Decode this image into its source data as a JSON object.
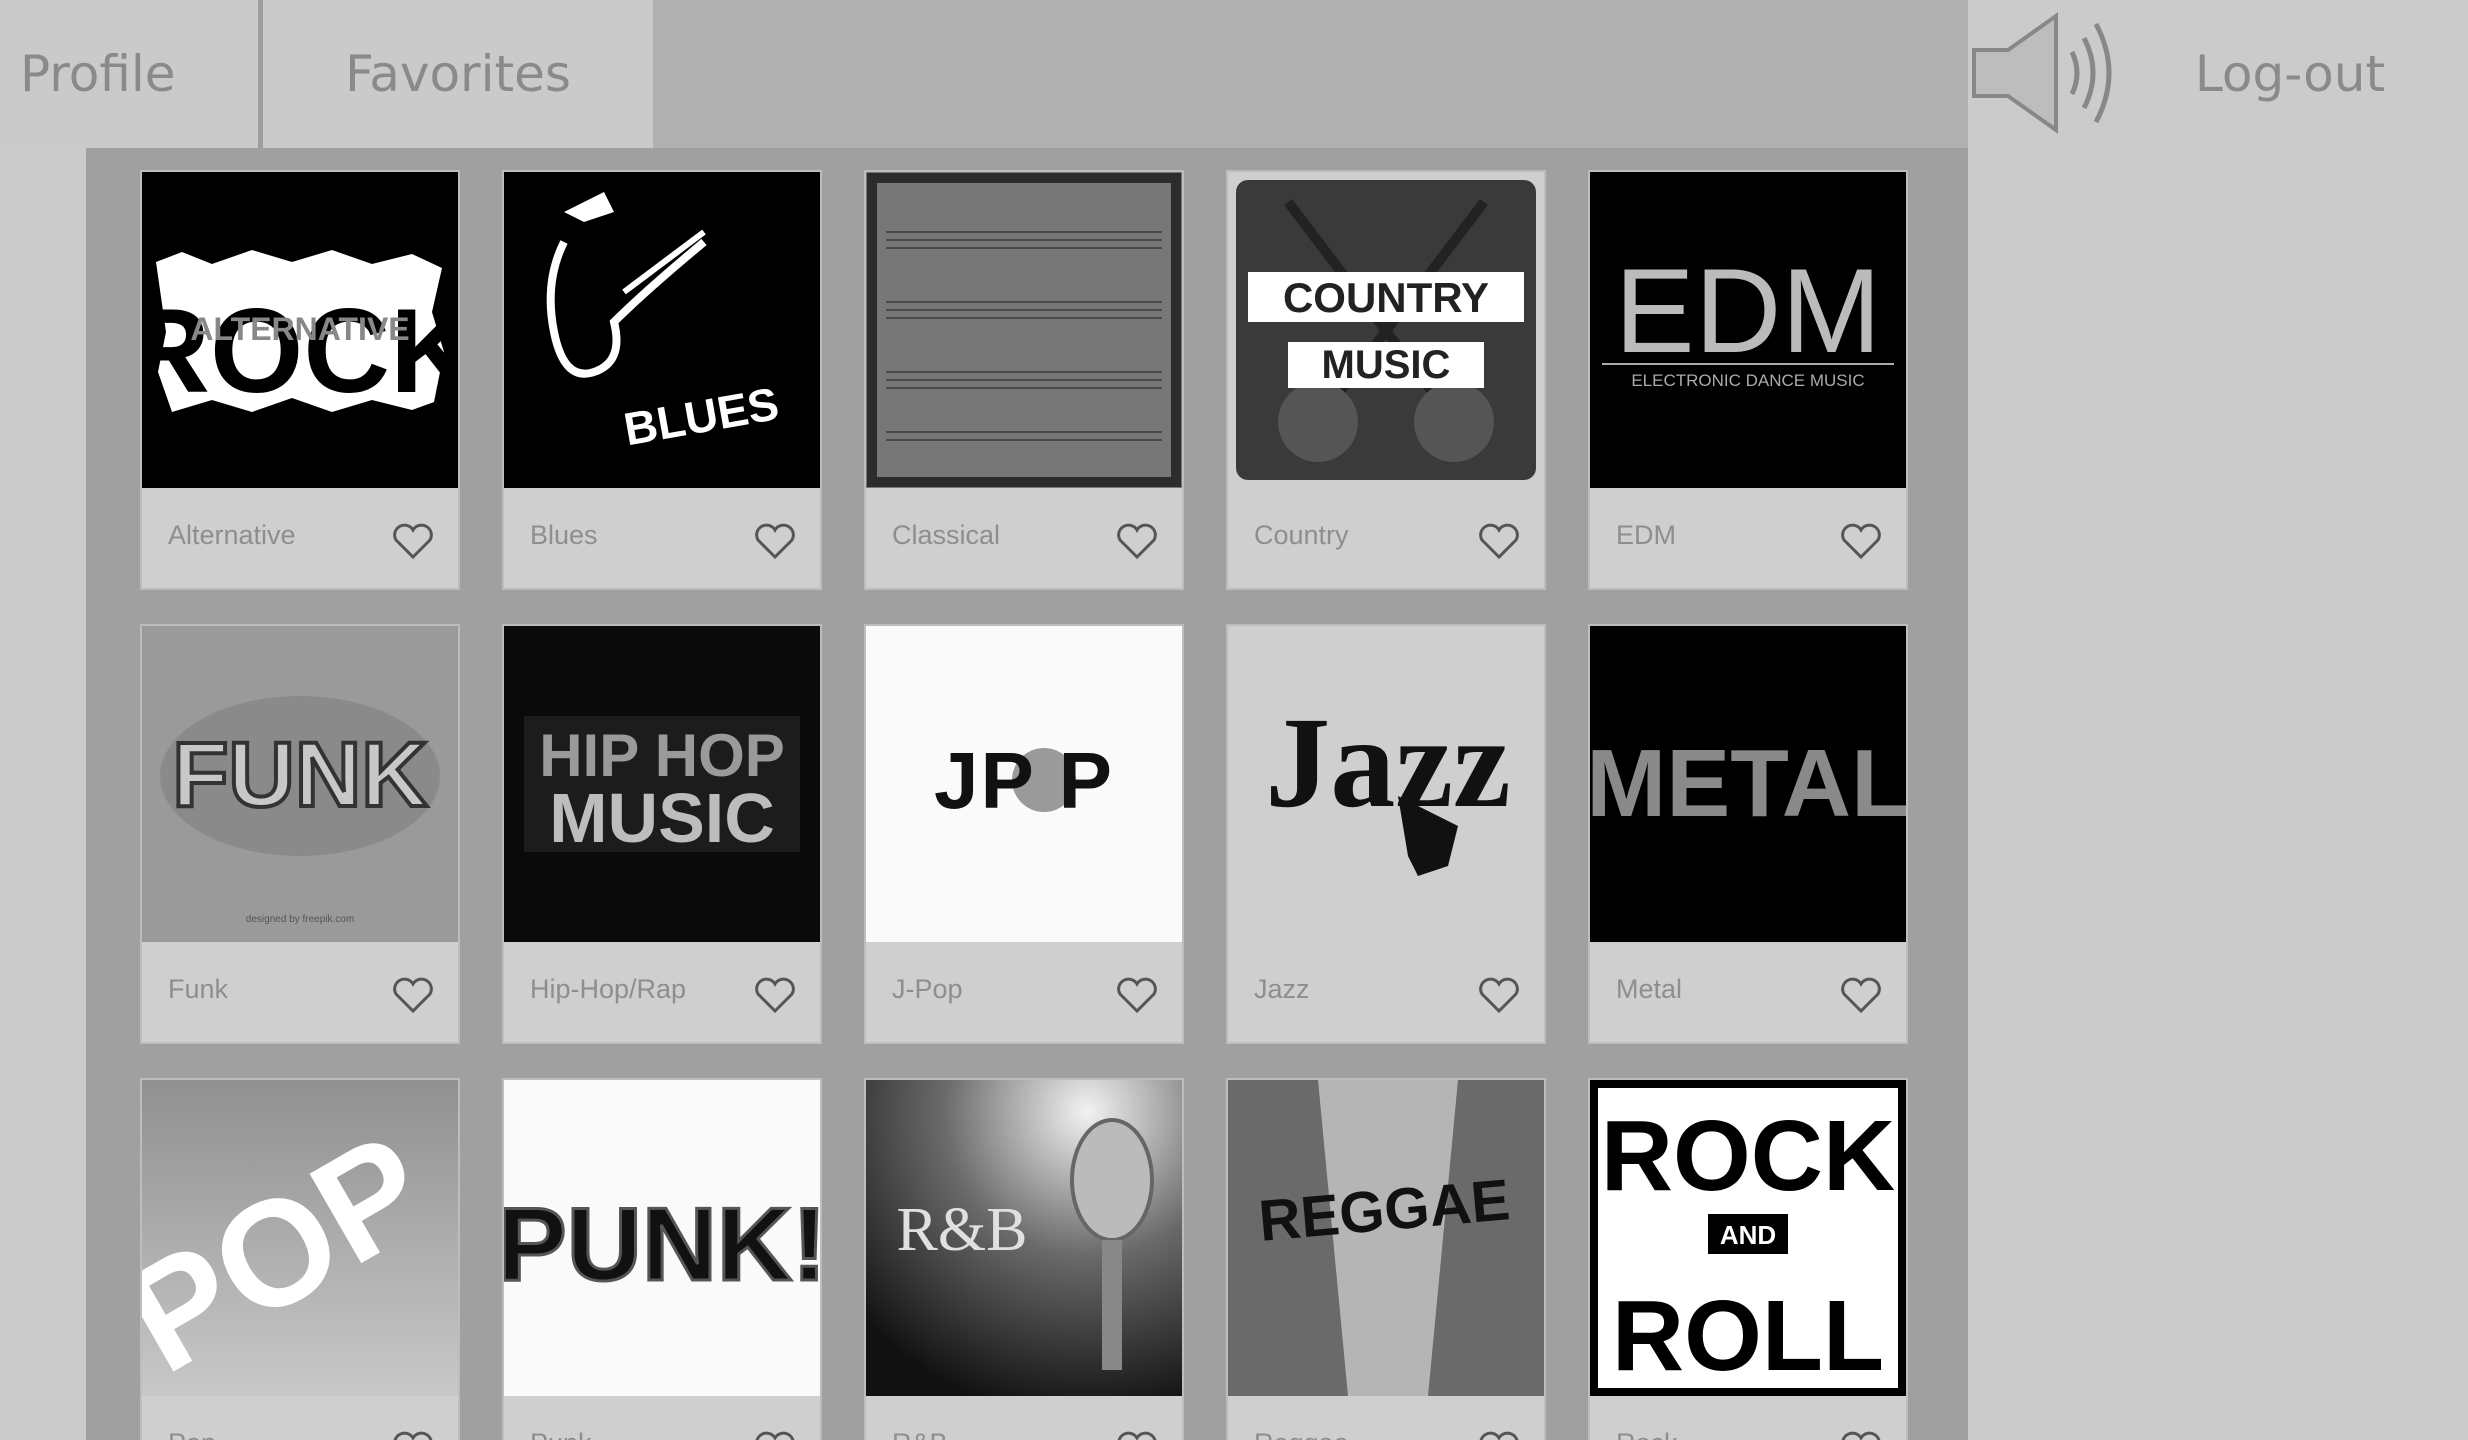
{
  "nav": {
    "profile_label": "Profile",
    "favorites_label": "Favorites",
    "logout_label": "Log-out",
    "volume_icon": "speaker-volume-icon"
  },
  "genres": [
    {
      "label": "Alternative",
      "art": "ROCK",
      "art_sub": "ALTERNATIVE"
    },
    {
      "label": "Blues",
      "art": "BLUES"
    },
    {
      "label": "Classical"
    },
    {
      "label": "Country",
      "art": "COUNTRY",
      "art_sub": "MUSIC"
    },
    {
      "label": "EDM",
      "art": "EDM",
      "art_sub": "ELECTRONIC DANCE MUSIC"
    },
    {
      "label": "Funk",
      "art": "FUNK",
      "art_sub": "designed by freepik.com"
    },
    {
      "label": "Hip-Hop/Rap",
      "art": "HIP HOP",
      "art_sub": "MUSIC"
    },
    {
      "label": "J-Pop",
      "art": "JP P"
    },
    {
      "label": "Jazz",
      "art": "Jazz"
    },
    {
      "label": "Metal",
      "art": "METAL"
    },
    {
      "label": "Pop",
      "art": "POP"
    },
    {
      "label": "Punk",
      "art": "PUNK!"
    },
    {
      "label": "R&B",
      "art": "R&B"
    },
    {
      "label": "Reggae",
      "art": "REGGAE"
    },
    {
      "label": "Rock",
      "art": "ROCK",
      "art_mid": "AND",
      "art_sub": "ROLL"
    }
  ],
  "colors": {
    "background": "#cbcbcb",
    "nav": "#b0b0b0",
    "panel": "#a0a0a0",
    "card": "#cfcfcf"
  }
}
